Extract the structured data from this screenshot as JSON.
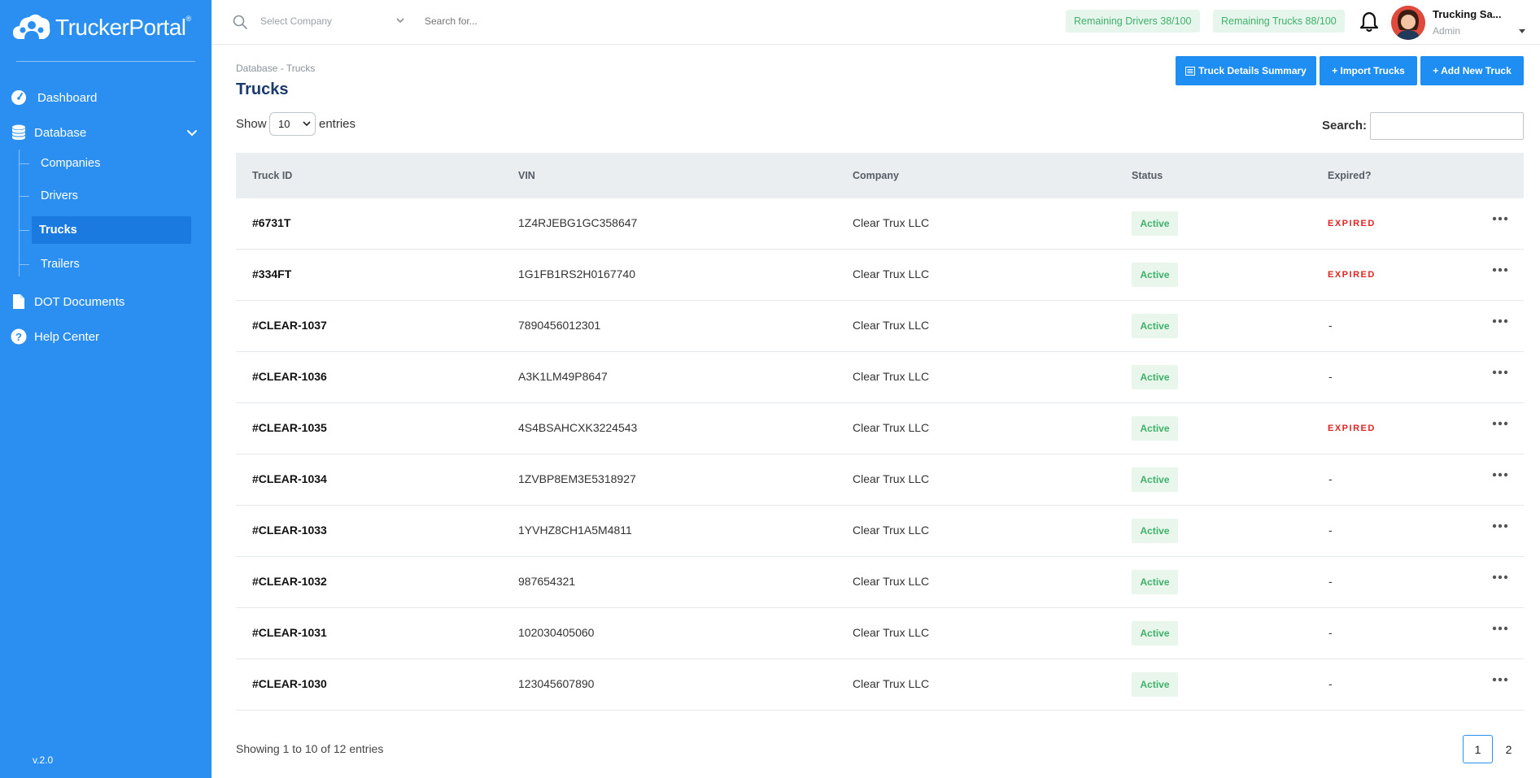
{
  "brand": {
    "name": "TruckerPortal",
    "mark": "®",
    "version": "v.2.0"
  },
  "sidebar": {
    "items": [
      {
        "label": "Dashboard"
      },
      {
        "label": "Database"
      },
      {
        "label": "DOT Documents"
      },
      {
        "label": "Help Center"
      }
    ],
    "subitems": [
      {
        "label": "Companies"
      },
      {
        "label": "Drivers"
      },
      {
        "label": "Trucks"
      },
      {
        "label": "Trailers"
      }
    ]
  },
  "topbar": {
    "company_placeholder": "Select Company",
    "search_placeholder": "Search for...",
    "drivers_pill": "Remaining Drivers 38/100",
    "trucks_pill": "Remaining Trucks 88/100",
    "user_name": "Trucking Sa...",
    "user_role": "Admin"
  },
  "page": {
    "breadcrumb": "Database - Trucks",
    "title": "Trucks",
    "buttons": {
      "summary": "Truck Details Summary",
      "import": "+ Import Trucks",
      "add": "+ Add New Truck"
    },
    "show_label": "Show",
    "entries_value": "10",
    "entries_label": "entries",
    "search_label": "Search:"
  },
  "table": {
    "columns": [
      "Truck ID",
      "VIN",
      "Company",
      "Status",
      "Expired?"
    ],
    "rows": [
      {
        "id": "#6731T",
        "vin": "1Z4RJEBG1GC358647",
        "company": "Clear Trux LLC",
        "status": "Active",
        "expired": "EXPIRED"
      },
      {
        "id": "#334FT",
        "vin": "1G1FB1RS2H0167740",
        "company": "Clear Trux LLC",
        "status": "Active",
        "expired": "EXPIRED"
      },
      {
        "id": "#CLEAR-1037",
        "vin": "7890456012301",
        "company": "Clear Trux LLC",
        "status": "Active",
        "expired": "-"
      },
      {
        "id": "#CLEAR-1036",
        "vin": "A3K1LM49P8647",
        "company": "Clear Trux LLC",
        "status": "Active",
        "expired": "-"
      },
      {
        "id": "#CLEAR-1035",
        "vin": "4S4BSAHCXK3224543",
        "company": "Clear Trux LLC",
        "status": "Active",
        "expired": "EXPIRED"
      },
      {
        "id": "#CLEAR-1034",
        "vin": "1ZVBP8EM3E5318927",
        "company": "Clear Trux LLC",
        "status": "Active",
        "expired": "-"
      },
      {
        "id": "#CLEAR-1033",
        "vin": "1YVHZ8CH1A5M4811",
        "company": "Clear Trux LLC",
        "status": "Active",
        "expired": "-"
      },
      {
        "id": "#CLEAR-1032",
        "vin": "987654321",
        "company": "Clear Trux LLC",
        "status": "Active",
        "expired": "-"
      },
      {
        "id": "#CLEAR-1031",
        "vin": "102030405060",
        "company": "Clear Trux LLC",
        "status": "Active",
        "expired": "-"
      },
      {
        "id": "#CLEAR-1030",
        "vin": "123045607890",
        "company": "Clear Trux LLC",
        "status": "Active",
        "expired": "-"
      }
    ]
  },
  "footer": {
    "info": "Showing 1 to 10 of 12 entries",
    "pages": [
      "1",
      "2"
    ]
  },
  "colors": {
    "sidebar": "#2a8ff0",
    "accent": "#1e8ef2",
    "active_green": "#3fb06a",
    "expired_red": "#e02424"
  }
}
